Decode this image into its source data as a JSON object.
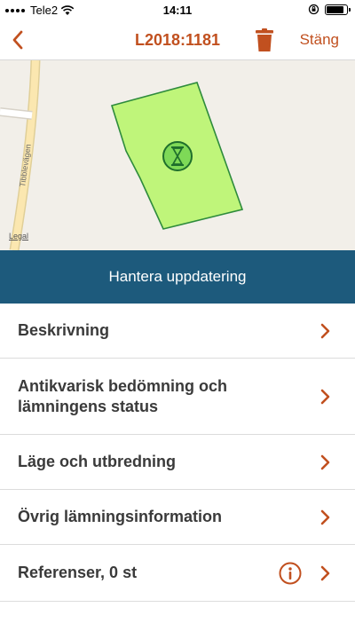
{
  "status_bar": {
    "carrier": "Tele2",
    "time": "14:11",
    "battery_level": 0.85,
    "icons": [
      "signal-icon",
      "wifi-icon",
      "rotation-lock-icon",
      "battery-icon"
    ]
  },
  "nav": {
    "title": "L2018:1181",
    "close_label": "Stäng",
    "icons": [
      "chevron-left-icon",
      "trash-icon"
    ]
  },
  "map": {
    "road_name": "Tibblevägen",
    "legal_label": "Legal",
    "polygon_color": "#bff57a",
    "polygon_stroke": "#2e8b3c",
    "marker_icon": "hourglass-icon"
  },
  "action_bar": {
    "label": "Hantera uppdatering",
    "color": "#1d5a7c"
  },
  "menu": {
    "items": [
      {
        "label": "Beskrivning"
      },
      {
        "label": "Antikvarisk bedömning och lämningens status"
      },
      {
        "label": "Läge och utbredning"
      },
      {
        "label": "Övrig lämningsinformation"
      },
      {
        "label": "Referenser, 0 st"
      }
    ]
  },
  "colors": {
    "accent": "#c1501f",
    "map_background": "#f2efe9",
    "road": "#fbe7b0"
  }
}
